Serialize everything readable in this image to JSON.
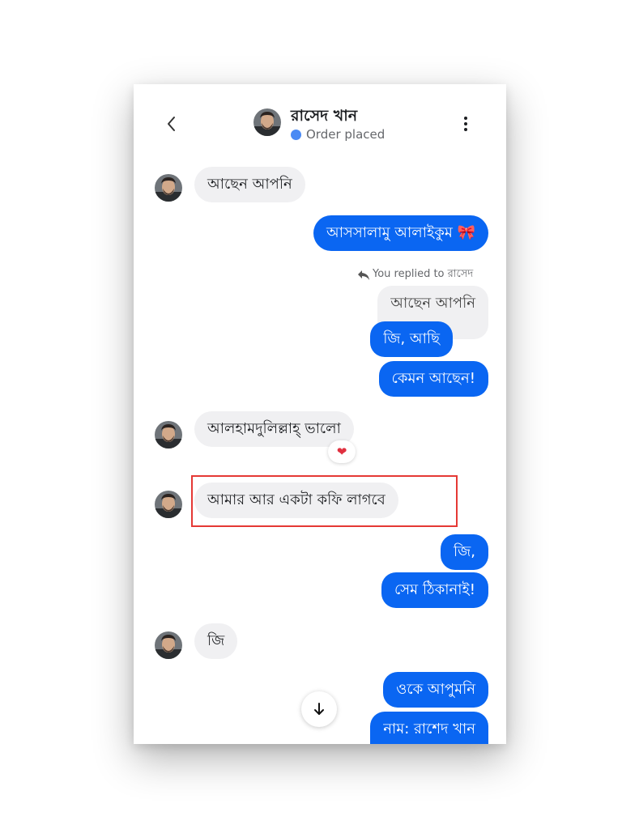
{
  "header": {
    "contact_name": "রাসেদ খান",
    "status": "Order placed",
    "status_color": "#4a8af4"
  },
  "messages": [
    {
      "direction": "incoming",
      "text": "আছেন  আপনি"
    },
    {
      "direction": "outgoing",
      "text": "আসসালামু আলাইকুম 🎀"
    },
    {
      "direction": "outgoing",
      "reply_label": "You replied to রাসেদ",
      "quoted_text": "আছেন  আপনি",
      "text": "জি, আছি"
    },
    {
      "direction": "outgoing",
      "text": "কেমন আছেন!"
    },
    {
      "direction": "incoming",
      "text": "আলহামদুলিল্লাহ্ ভালো",
      "reaction": "❤"
    },
    {
      "direction": "incoming",
      "text": "আমার  আর একটা কফি লাগবে",
      "highlighted": true,
      "highlight_color": "#e53935"
    },
    {
      "direction": "outgoing",
      "text": "জি,"
    },
    {
      "direction": "outgoing",
      "text": "সেম ঠিকানাই!"
    },
    {
      "direction": "incoming",
      "text": "জি"
    },
    {
      "direction": "outgoing",
      "text": "ওকে আপুমনি"
    },
    {
      "direction": "outgoing",
      "text": "নাম:  রাশেদ খান"
    }
  ],
  "icons": {
    "back": "chevron-left-icon",
    "menu": "more-vertical-icon",
    "reply": "reply-icon",
    "scroll": "arrow-down-icon"
  },
  "colors": {
    "outgoing_bubble": "#0a66f2",
    "incoming_bubble": "#f0f0f2"
  }
}
